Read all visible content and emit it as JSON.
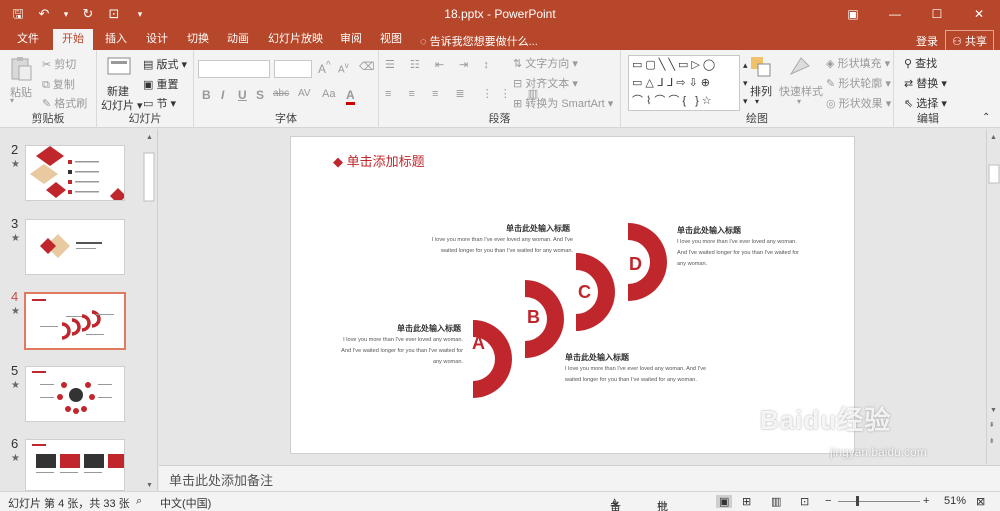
{
  "window": {
    "title": "18.pptx - PowerPoint",
    "controls": [
      "▣",
      "—",
      "☐",
      "✕"
    ]
  },
  "quick_access": {
    "save_icon": "🖫",
    "undo_icon": "↶",
    "undo_arrow": "▾",
    "redo_icon": "↻",
    "present_icon": "⊡",
    "customize_icon": "▾"
  },
  "tabs": [
    {
      "label": "文件"
    },
    {
      "label": "开始"
    },
    {
      "label": "插入"
    },
    {
      "label": "设计"
    },
    {
      "label": "切换"
    },
    {
      "label": "动画"
    },
    {
      "label": "幻灯片放映"
    },
    {
      "label": "审阅"
    },
    {
      "label": "视图"
    }
  ],
  "tell_me": "告诉我您想要做什么...",
  "login": "登录",
  "share": "共享",
  "ribbon": {
    "clipboard": {
      "paste": "粘贴",
      "cut": "剪切",
      "copy": "复制",
      "format_painter": "格式刷",
      "label": "剪贴板"
    },
    "slides": {
      "new_slide": "新建",
      "new_slide2": "幻灯片",
      "layout": "版式",
      "reset": "重置",
      "section": "节",
      "label": "幻灯片"
    },
    "font": {
      "label": "字体",
      "bold": "B",
      "italic": "I",
      "underline": "U",
      "strike": "S",
      "shadow": "abc",
      "spacing": "AV",
      "case": "Aa",
      "color": "A"
    },
    "paragraph": {
      "text_direction": "文字方向",
      "align_text": "对齐文本",
      "smartart": "转换为 SmartArt",
      "label": "段落"
    },
    "drawing": {
      "arrange": "排列",
      "quick_styles": "快速样式",
      "fill": "形状填充",
      "outline": "形状轮廓",
      "effects": "形状效果",
      "label": "绘图"
    },
    "editing": {
      "find": "查找",
      "replace": "替换",
      "select": "选择",
      "label": "编辑"
    }
  },
  "slides_panel": [
    {
      "num": "2",
      "star": "★"
    },
    {
      "num": "3",
      "star": "★"
    },
    {
      "num": "4",
      "star": "★"
    },
    {
      "num": "5",
      "star": "★"
    },
    {
      "num": "6",
      "star": "★"
    }
  ],
  "slide": {
    "title": "◆ 单击添加标题",
    "letters": [
      "A",
      "B",
      "C",
      "D"
    ],
    "items": [
      {
        "heading": "单击此处输入标题",
        "line1": "I love you more than I've ever loved any woman. And I've",
        "line2": "waited longer for you than I've waited for any woman."
      },
      {
        "heading": "单击此处输入标题",
        "line1": "I love you more than I've ever loved any woman.",
        "line2": "And I've waited longer for you than I've waited for",
        "line3": "any woman."
      },
      {
        "heading": "单击此处输入标题",
        "line1": "I love you more than I've ever loved any woman.",
        "line2": "And I've waited longer for you than I've waited for",
        "line3": "any woman."
      },
      {
        "heading": "单击此处输入标题",
        "line1": "I love you more than I've ever loved any woman. And I've",
        "line2": "waited longer for you than I've waited for any woman."
      }
    ]
  },
  "notes_placeholder": "单击此处添加备注",
  "status": {
    "slide_info": "幻灯片 第 4 张，共 33 张",
    "language": "中文(中国)",
    "notes": "备注",
    "comments": "批注",
    "zoom": "51%",
    "zoom_level": 0.51
  },
  "colors": {
    "accent": "#b7472a",
    "slide_red": "#c0272d"
  },
  "watermark": {
    "brand": "Baidu经验",
    "url": "jingyan.baidu.com"
  }
}
